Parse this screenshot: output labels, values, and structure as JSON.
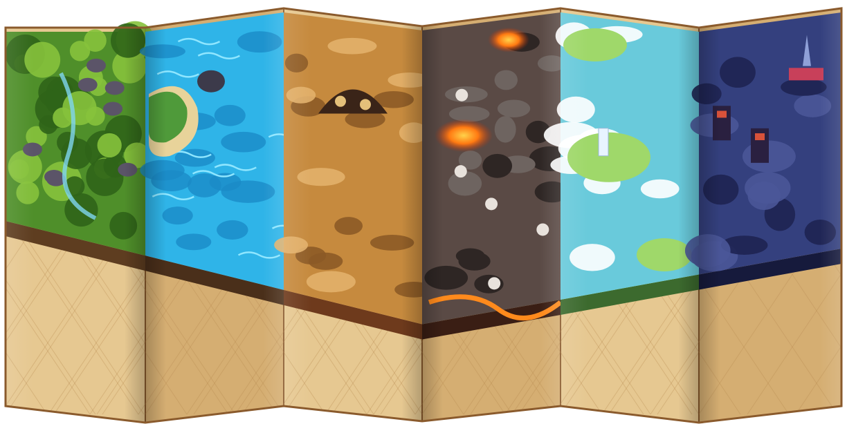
{
  "map": {
    "regions": [
      {
        "id": "forest",
        "biome": "forest",
        "base": "#4f8f2a",
        "accent": "#2f6418",
        "detail": "#86c23c",
        "soil": "#5e3d20"
      },
      {
        "id": "ocean",
        "biome": "ocean",
        "base": "#2fb4e8",
        "accent": "#1a8bc7",
        "detail": "#8fe6ff",
        "soil": "#4a2f1a"
      },
      {
        "id": "desert",
        "biome": "desert",
        "base": "#c68a3e",
        "accent": "#8c5a26",
        "detail": "#e2b06a",
        "soil": "#6e3a1c"
      },
      {
        "id": "volcano",
        "biome": "volcano",
        "base": "#5a4a45",
        "accent": "#2e2624",
        "detail": "#ff8a1c",
        "soil": "#3a1e14"
      },
      {
        "id": "sky-islands",
        "biome": "sky",
        "base": "#9fd86a",
        "accent": "#5fc8ee",
        "detail": "#ffffff",
        "soil": "#3c6a2e"
      },
      {
        "id": "dark-fortress",
        "biome": "dark",
        "base": "#34407e",
        "accent": "#1e2452",
        "detail": "#d8523a",
        "soil": "#161a3c"
      }
    ],
    "parchment_colors": {
      "light": "#e6c891",
      "mid": "#d5ae72",
      "dark": "#b88a50",
      "edge": "#8a5a2c"
    }
  }
}
